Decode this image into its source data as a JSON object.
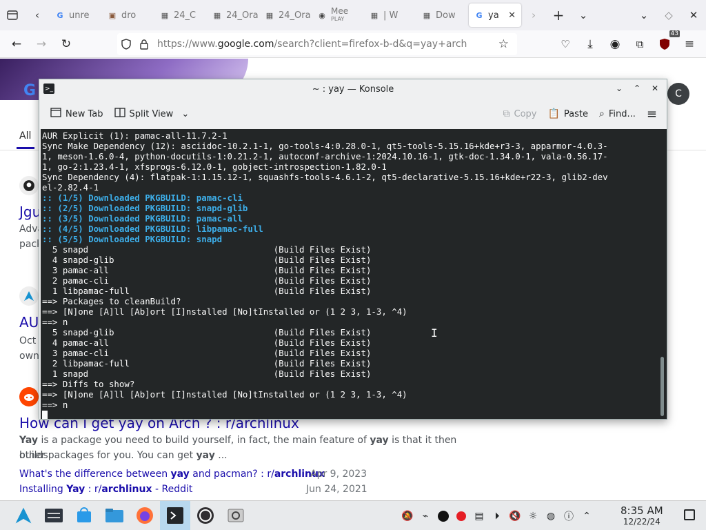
{
  "browser": {
    "tabs": [
      {
        "label": "unre",
        "icon": "google-favicon"
      },
      {
        "label": "dro",
        "icon": "image-favicon"
      },
      {
        "label": "24_C",
        "icon": "page-favicon"
      },
      {
        "label": "24_Ora",
        "icon": "page-favicon"
      },
      {
        "label": "24_Ora",
        "icon": "page-favicon"
      },
      {
        "label": "Mee",
        "sub": "PLAY",
        "icon": "audio-favicon"
      },
      {
        "label": "| W",
        "icon": "page-favicon"
      },
      {
        "label": "Dow",
        "icon": "page-favicon"
      },
      {
        "label": "ya",
        "icon": "google-favicon",
        "active": true
      }
    ],
    "url_prefix": "https://www.",
    "url_host": "google.com",
    "url_rest": "/search?client=firefox-b-d&q=yay+arch",
    "extension_badge": "43"
  },
  "google": {
    "avatar_letter": "C",
    "tab_all": "All",
    "results": [
      {
        "title": "Jgu",
        "snippet": "Adva",
        "snippet2": "pack"
      },
      {
        "title": "AUI",
        "snippet": "Oct",
        "snippet2": "own"
      },
      {
        "title": "How can I get yay on Arch ? : r/archlinux",
        "snippet_parts": [
          {
            "b": "Yay"
          },
          {
            "t": " is a package you need to build yourself, in fact, the main feature of "
          },
          {
            "b": "yay"
          },
          {
            "t": " is that it then builds"
          }
        ],
        "snippet2_parts": [
          {
            "t": "other packages for you. You can get "
          },
          {
            "b": "yay"
          },
          {
            "t": " ..."
          }
        ]
      }
    ],
    "sublinks": [
      {
        "parts": [
          {
            "t": "What's the difference between "
          },
          {
            "b": "yay"
          },
          {
            "t": " and pacman? : r/"
          },
          {
            "b": "archlinux"
          }
        ],
        "date": "Apr 9, 2023"
      },
      {
        "parts": [
          {
            "t": "Installing "
          },
          {
            "b": "Yay"
          },
          {
            "t": " : r/"
          },
          {
            "b": "archlinux"
          },
          {
            "t": " - Reddit"
          }
        ],
        "date": "Jun 24, 2021"
      }
    ]
  },
  "konsole": {
    "title": "~ : yay — Konsole",
    "toolbar": {
      "new_tab": "New Tab",
      "split_view": "Split View",
      "copy": "Copy",
      "paste": "Paste",
      "find": "Find..."
    },
    "lines": [
      {
        "text": "AUR Explicit (1): pamac-all-11.7.2-1"
      },
      {
        "text": "Sync Make Dependency (12): asciidoc-10.2.1-1, go-tools-4:0.28.0-1, qt5-tools-5.15.16+kde+r3-3, apparmor-4.0.3-"
      },
      {
        "text": "1, meson-1.6.0-4, python-docutils-1:0.21.2-1, autoconf-archive-1:2024.10.16-1, gtk-doc-1.34.0-1, vala-0.56.17-"
      },
      {
        "text": "1, go-2:1.23.4-1, xfsprogs-6.12.0-1, gobject-introspection-1.82.0-1"
      },
      {
        "text": "Sync Dependency (4): flatpak-1:1.15.12-1, squashfs-tools-4.6.1-2, qt5-declarative-5.15.16+kde+r22-3, glib2-dev"
      },
      {
        "text": "el-2.82.4-1"
      },
      {
        "text": ":: (1/5) Downloaded PKGBUILD: pamac-cli",
        "style": "blue"
      },
      {
        "text": ":: (2/5) Downloaded PKGBUILD: snapd-glib",
        "style": "blue"
      },
      {
        "text": ":: (3/5) Downloaded PKGBUILD: pamac-all",
        "style": "blue"
      },
      {
        "text": ":: (4/5) Downloaded PKGBUILD: libpamac-full",
        "style": "blue"
      },
      {
        "text": ":: (5/5) Downloaded PKGBUILD: snapd",
        "style": "blue"
      },
      {
        "text": "  5 snapd                                    (Build Files Exist)"
      },
      {
        "text": "  4 snapd-glib                               (Build Files Exist)"
      },
      {
        "text": "  3 pamac-all                                (Build Files Exist)"
      },
      {
        "text": "  2 pamac-cli                                (Build Files Exist)"
      },
      {
        "text": "  1 libpamac-full                            (Build Files Exist)"
      },
      {
        "text": "==> Packages to cleanBuild?"
      },
      {
        "text": "==> [N]one [A]ll [Ab]ort [I]nstalled [No]tInstalled or (1 2 3, 1-3, ^4)"
      },
      {
        "text": "==> n"
      },
      {
        "text": "  5 snapd-glib                               (Build Files Exist)"
      },
      {
        "text": "  4 pamac-all                                (Build Files Exist)"
      },
      {
        "text": "  3 pamac-cli                                (Build Files Exist)"
      },
      {
        "text": "  2 libpamac-full                            (Build Files Exist)"
      },
      {
        "text": "  1 snapd                                    (Build Files Exist)"
      },
      {
        "text": "==> Diffs to show?"
      },
      {
        "text": "==> [N]one [A]ll [Ab]ort [I]nstalled [No]tInstalled or (1 2 3, 1-3, ^4)"
      },
      {
        "text": "==> n"
      },
      {
        "text": "",
        "cursor": true
      }
    ]
  },
  "taskbar": {
    "time": "8:35 AM",
    "date": "12/22/24"
  },
  "colors": {
    "terminal_bg": "#232627",
    "terminal_fg": "#fcfcfc",
    "terminal_blue": "#3daee9",
    "link": "#1a0dab"
  }
}
